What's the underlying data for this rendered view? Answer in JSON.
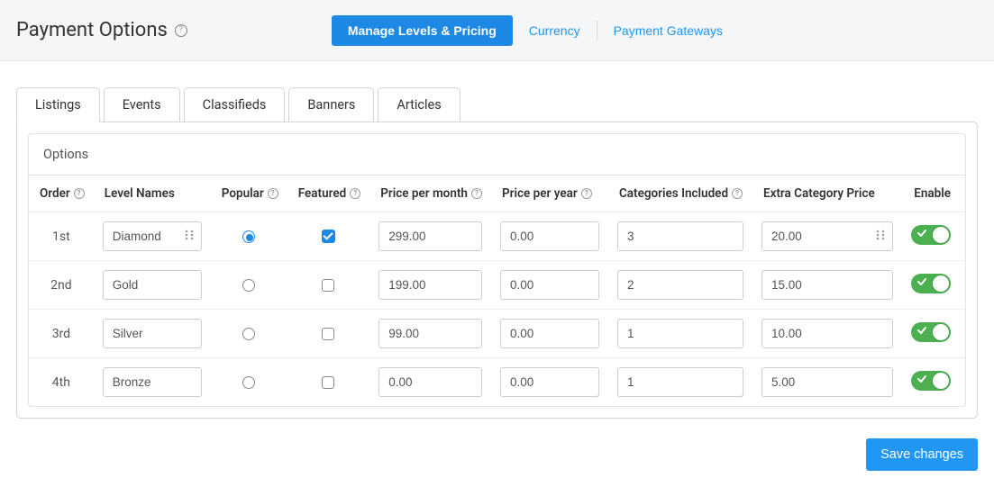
{
  "header": {
    "title": "Payment Options",
    "nav": {
      "active": "Manage Levels & Pricing",
      "currency": "Currency",
      "gateways": "Payment Gateways"
    }
  },
  "tabs": [
    "Listings",
    "Events",
    "Classifieds",
    "Banners",
    "Articles"
  ],
  "activeTab": 0,
  "panel": {
    "title": "Options",
    "columns": {
      "order": "Order",
      "level": "Level Names",
      "popular": "Popular",
      "featured": "Featured",
      "ppm": "Price per month",
      "ppy": "Price per year",
      "cats": "Categories Included",
      "extraCat": "Extra Category Price",
      "enable": "Enable"
    },
    "rows": [
      {
        "order": "1st",
        "name": "Diamond",
        "popular": true,
        "featured": true,
        "ppm": "299.00",
        "ppy": "0.00",
        "cats": "3",
        "extraCat": "20.00",
        "nameGrip": true,
        "extraGrip": true,
        "enabled": true
      },
      {
        "order": "2nd",
        "name": "Gold",
        "popular": false,
        "featured": false,
        "ppm": "199.00",
        "ppy": "0.00",
        "cats": "2",
        "extraCat": "15.00",
        "nameGrip": false,
        "extraGrip": false,
        "enabled": true
      },
      {
        "order": "3rd",
        "name": "Silver",
        "popular": false,
        "featured": false,
        "ppm": "99.00",
        "ppy": "0.00",
        "cats": "1",
        "extraCat": "10.00",
        "nameGrip": false,
        "extraGrip": false,
        "enabled": true
      },
      {
        "order": "4th",
        "name": "Bronze",
        "popular": false,
        "featured": false,
        "ppm": "0.00",
        "ppy": "0.00",
        "cats": "1",
        "extraCat": "5.00",
        "nameGrip": false,
        "extraGrip": false,
        "enabled": true
      }
    ]
  },
  "buttons": {
    "save": "Save changes"
  }
}
